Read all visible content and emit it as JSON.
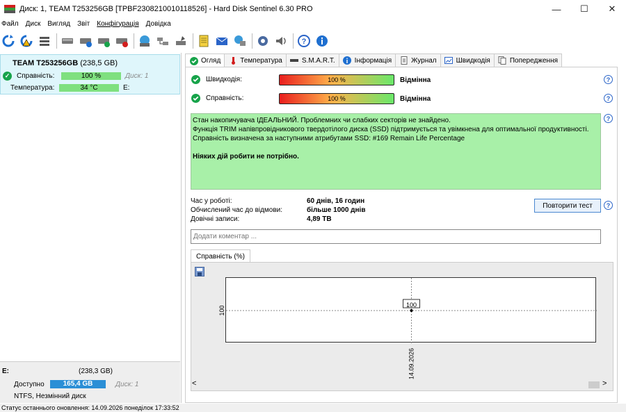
{
  "window": {
    "title": "Диск: 1, TEAM T253256GB [TPBF2308210010118526]  -  Hard Disk Sentinel 6.30 PRO",
    "minimize": "—",
    "maximize": "☐",
    "close": "✕"
  },
  "menu": {
    "items": [
      "Файл",
      "Диск",
      "Вигляд",
      "Звіт",
      "Конфігурація",
      "Довідка"
    ]
  },
  "toolbar": {
    "icons": [
      "refresh-icon",
      "refresh-warning-icon",
      "disk-list-icon",
      "disk-icon",
      "disk-info-icon",
      "disk-ok-icon",
      "disk-remove-icon",
      "globe-disk-icon",
      "network-icon",
      "disk-tools-icon",
      "notes-icon",
      "mail-icon",
      "transfer-icon",
      "settings-icon",
      "sound-icon",
      "help-icon",
      "info-icon"
    ]
  },
  "left": {
    "disk_name": "TEAM T253256GB",
    "disk_size": "(238,5 GB)",
    "health_label": "Справність:",
    "health_value": "100 %",
    "health_level": 1.0,
    "disk_num": "Диск: 1",
    "temp_label": "Температура:",
    "temp_value": "34 °C",
    "temp_drive": "E:",
    "vol_letter": "E:",
    "vol_size": "(238,3 GB)",
    "free_label": "Доступно",
    "free_value": "165,4 GB",
    "vol_disk": "Диск: 1",
    "vol_fs": "NTFS, Незмінний диск"
  },
  "tabs": [
    {
      "label": "Огляд",
      "icon": "check-icon"
    },
    {
      "label": "Температура",
      "icon": "thermometer-icon"
    },
    {
      "label": "S.M.A.R.T.",
      "icon": "smart-icon"
    },
    {
      "label": "Інформація",
      "icon": "info-icon"
    },
    {
      "label": "Журнал",
      "icon": "document-icon"
    },
    {
      "label": "Швидкодія",
      "icon": "performance-icon"
    },
    {
      "label": "Попередження",
      "icon": "alerts-icon"
    }
  ],
  "overview": {
    "perf_label": "Швидкодія:",
    "perf_value": "100 %",
    "perf_status": "Відмінна",
    "health_label": "Справність:",
    "health_value": "100 %",
    "health_status": "Відмінна",
    "status_line1": "Стан накопичувача ІДЕАЛЬНИЙ. Проблемних чи слабких секторів не знайдено.",
    "status_line2": "Функція TRIM напівпровідникового твердотілого диска (SSD) підтримується та увімкнена для оптимальної продуктивності.",
    "status_line3": "Справність визначена за наступними атрибутами SSD:  #169 Remain Life Percentage",
    "status_action": "Ніяких дій робити не потрібно.",
    "uptime_label": "Час у роботі:",
    "uptime_value": "60 днів, 16 годин",
    "failure_label": "Обчислений час до відмови:",
    "failure_value": "більше 1000 днів",
    "writes_label": "Довічні записи:",
    "writes_value": "4,89 TB",
    "retest_button": "Повторити тест",
    "comment_placeholder": "Додати коментар ...",
    "chart_tab": "Справність (%)",
    "help": "?"
  },
  "chart_data": {
    "type": "line",
    "x": [
      "14.09.2026"
    ],
    "series": [
      {
        "values": [
          100
        ]
      }
    ],
    "data_labels": [
      "100"
    ],
    "ytick": "100",
    "xtick": "14.09.2026",
    "grid": true
  },
  "scroll": {
    "left": "<",
    "right": ">"
  },
  "statusbar": {
    "text": "Статус останнього оновлення: 14.09.2026 понеділок 17:33:52"
  },
  "colors": {
    "accent_green": "#17a34a",
    "health_green": "#7fe07f",
    "status_bg": "#a8f0a8",
    "volume_blue": "#2b8fd6"
  }
}
